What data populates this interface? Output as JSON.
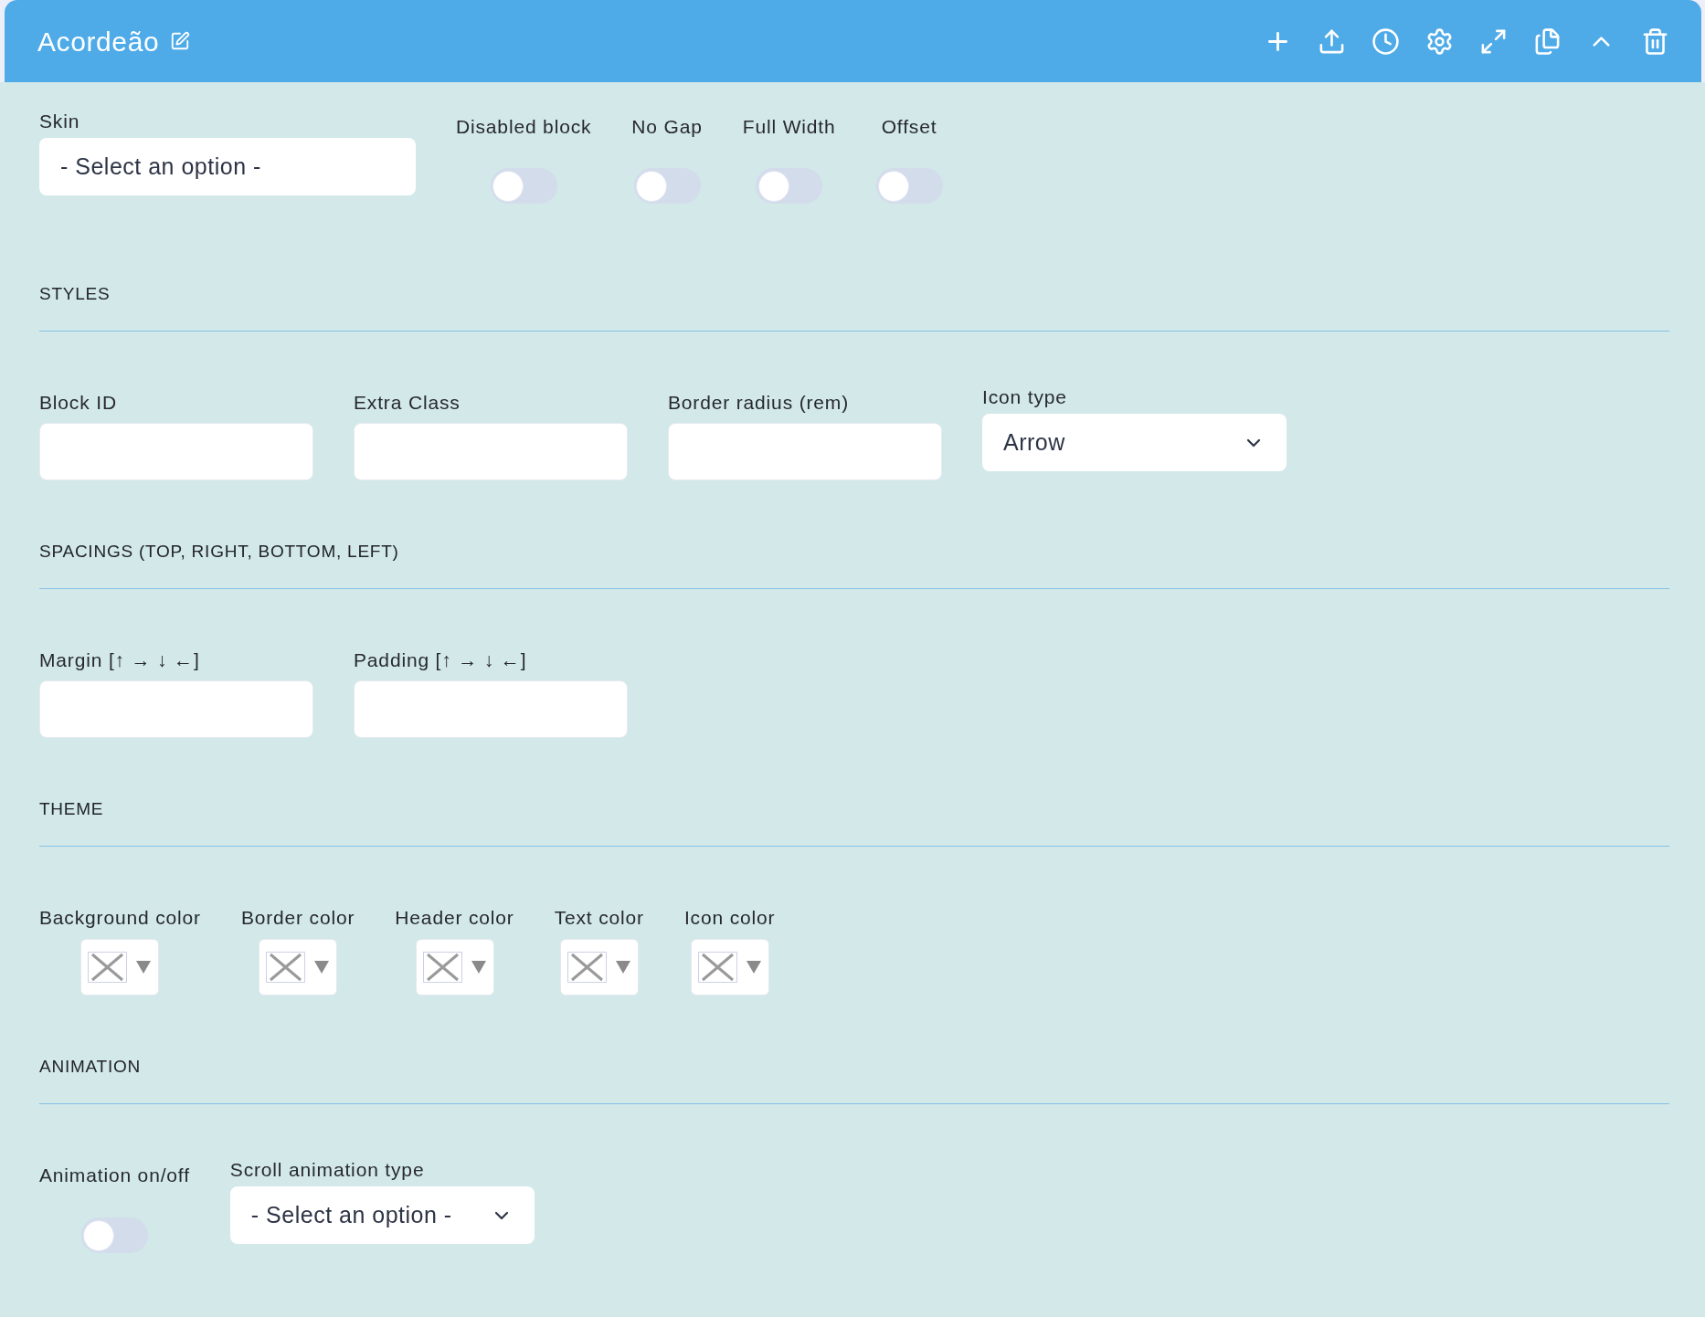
{
  "header": {
    "title": "Acordeão"
  },
  "general": {
    "skin": {
      "label": "Skin",
      "value": "- Select an option -"
    },
    "switches": [
      {
        "label": "Disabled block",
        "on": false
      },
      {
        "label": "No Gap",
        "on": false
      },
      {
        "label": "Full Width",
        "on": false
      },
      {
        "label": "Offset",
        "on": false
      }
    ]
  },
  "sections": [
    {
      "title": "STYLES",
      "fields": [
        {
          "kind": "text",
          "label": "Block ID"
        },
        {
          "kind": "text",
          "label": "Extra Class"
        },
        {
          "kind": "text",
          "label": "Border radius (rem)"
        },
        {
          "kind": "select",
          "label": "Icon type",
          "value": "Arrow"
        }
      ]
    },
    {
      "title": "SPACINGS (TOP, RIGHT, BOTTOM, LEFT)",
      "fields": [
        {
          "kind": "text",
          "label": "Margin [↑ → ↓ ←]"
        },
        {
          "kind": "text",
          "label": "Padding [↑ → ↓ ←]"
        }
      ]
    },
    {
      "title": "THEME",
      "fields": [
        {
          "kind": "color",
          "label": "Background color"
        },
        {
          "kind": "color",
          "label": "Border color"
        },
        {
          "kind": "color",
          "label": "Header color"
        },
        {
          "kind": "color",
          "label": "Text color"
        },
        {
          "kind": "color",
          "label": "Icon color"
        }
      ]
    },
    {
      "title": "ANIMATION",
      "fields": [
        {
          "kind": "switch",
          "label": "Animation on/off",
          "on": false
        },
        {
          "kind": "select",
          "label": "Scroll animation type",
          "value": "- Select an option -"
        }
      ]
    }
  ]
}
